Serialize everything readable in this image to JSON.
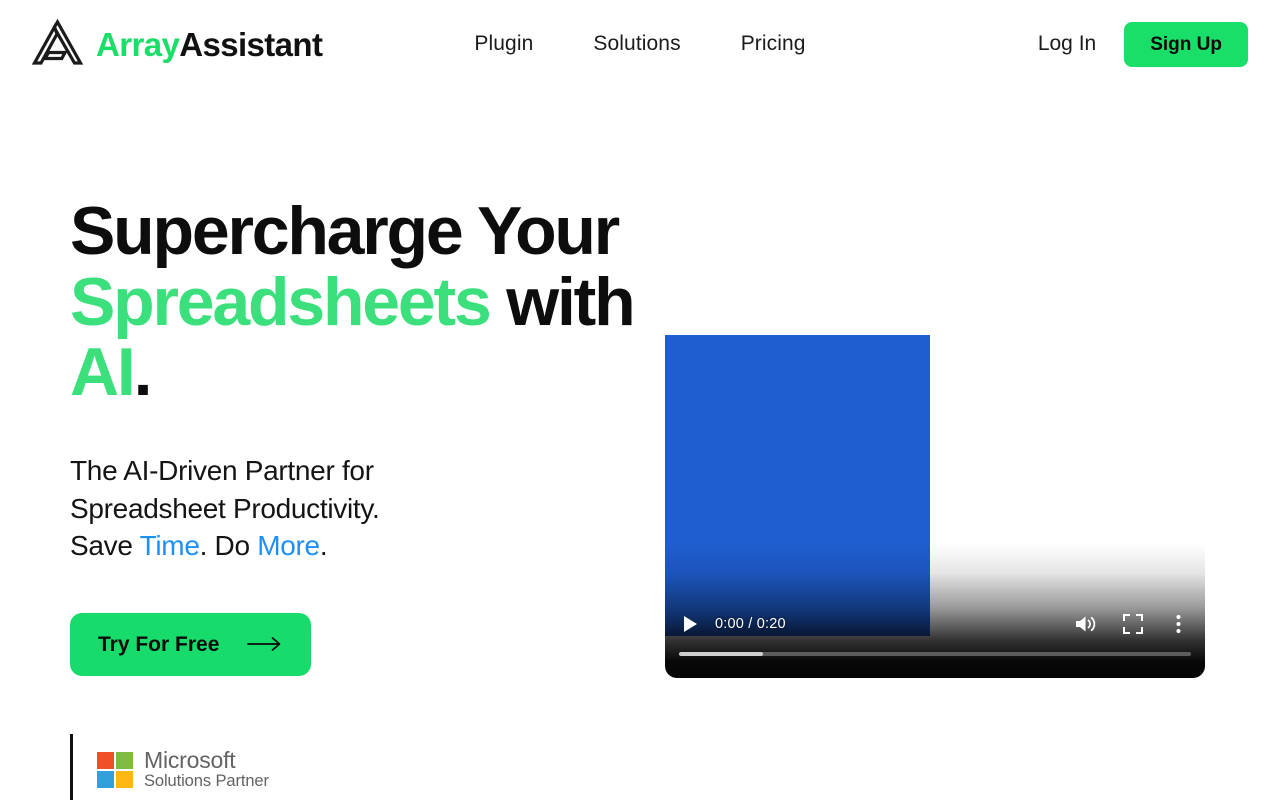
{
  "header": {
    "brand": {
      "icon": "array-assistant-logo-icon",
      "name_first": "Array",
      "name_second": "Assistant"
    },
    "nav": [
      {
        "label": "Plugin"
      },
      {
        "label": "Solutions"
      },
      {
        "label": "Pricing"
      }
    ],
    "login_label": "Log In",
    "signup_label": "Sign Up"
  },
  "hero": {
    "title": {
      "line1": "Supercharge Your",
      "line2_green": "Spreadsheets",
      "line2_mid": " with ",
      "line2_green2": "AI",
      "line2_end": "."
    },
    "subtitle": {
      "line1": "The AI-Driven Partner for",
      "line2": "Spreadsheet Productivity.",
      "line3_pre": "Save ",
      "line3_blue1": "Time",
      "line3_mid": ". Do ",
      "line3_blue2": "More",
      "line3_end": "."
    },
    "cta_label": "Try For Free",
    "cta_icon": "arrow-right-icon",
    "partner": {
      "logo_icon": "microsoft-logo-icon",
      "title": "Microsoft",
      "subtitle": "Solutions Partner"
    }
  },
  "video": {
    "play_icon": "play-icon",
    "time_display": "0:00 / 0:20",
    "current_time": "0:00",
    "duration": "0:20",
    "volume_icon": "volume-on-icon",
    "fullscreen_icon": "fullscreen-icon",
    "more_icon": "more-vertical-icon",
    "progress_percent": 0,
    "buffered_percent": 16.5
  },
  "colors": {
    "brand_green": "#19DE68",
    "accent_green": "#3BE07D",
    "accent_blue": "#1D90F5",
    "cta_green": "#17DB6B",
    "video_blue": "#1F5ED0",
    "ms_red": "#EF5126",
    "ms_green": "#7FBA42",
    "ms_blue": "#33A0DB",
    "ms_yellow": "#FDB813"
  }
}
